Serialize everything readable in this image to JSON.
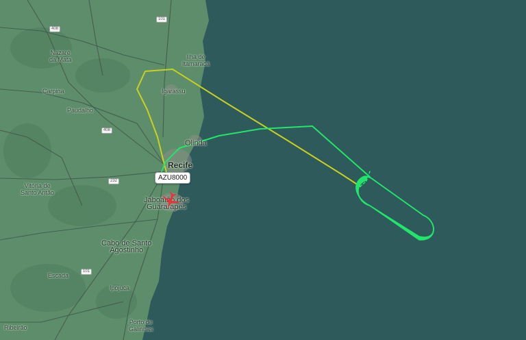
{
  "map": {
    "colors": {
      "ocean": "#2f5a5c",
      "land": "#5d8d6b",
      "track_start": "#c6d21e",
      "track_end": "#21e66a",
      "plane": "#e2383c"
    },
    "places": [
      {
        "key": "nazare",
        "text": "Nazaré\nda Mata"
      },
      {
        "key": "carpina",
        "text": "Carpina"
      },
      {
        "key": "paudalho",
        "text": "Paudalho"
      },
      {
        "key": "ilha",
        "text": "Ilha de\nItamaracá"
      },
      {
        "key": "igarassu",
        "text": "Igarassu"
      },
      {
        "key": "olinda",
        "text": "Olinda"
      },
      {
        "key": "recife",
        "text": "Recife"
      },
      {
        "key": "vitoria",
        "text": "Vitória de\nSanto Antão"
      },
      {
        "key": "jaboatao",
        "text": "Jaboatão dos\nGuararapes"
      },
      {
        "key": "cabo",
        "text": "Cabo de Santo\nAgostinho"
      },
      {
        "key": "escada",
        "text": "Escada"
      },
      {
        "key": "ipojuca",
        "text": "Ipojuca"
      },
      {
        "key": "ribeirao",
        "text": "Ribeirão"
      },
      {
        "key": "porto",
        "text": "Porto de\nGalinhas"
      }
    ],
    "road_shields": [
      "408",
      "101",
      "408",
      "232",
      "101"
    ],
    "flight": {
      "callsign": "AZU8000"
    }
  }
}
